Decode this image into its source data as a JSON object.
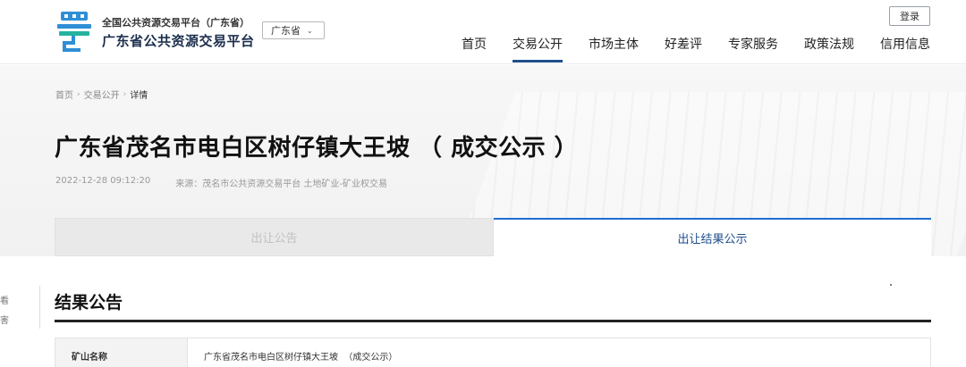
{
  "header": {
    "platform_line1": "全国公共资源交易平台（广东省）",
    "platform_line2": "广东省公共资源交易平台",
    "province_select": "广东省",
    "login_label": "登录",
    "nav": [
      {
        "label": "首页",
        "active": false
      },
      {
        "label": "交易公开",
        "active": true
      },
      {
        "label": "市场主体",
        "active": false
      },
      {
        "label": "好差评",
        "active": false
      },
      {
        "label": "专家服务",
        "active": false
      },
      {
        "label": "政策法规",
        "active": false
      },
      {
        "label": "信用信息",
        "active": false
      }
    ],
    "brand_color": "#1f6ed4"
  },
  "breadcrumb": {
    "items": [
      "首页",
      "交易公开",
      "详情"
    ]
  },
  "article": {
    "title": "广东省茂名市电白区树仔镇大王坡 （ 成交公示 ）",
    "datetime": "2022-12-28 09:12:20",
    "source": "来源：茂名市公共资源交易平台  土地矿业-矿业权交易"
  },
  "tabs": [
    {
      "label": "出让公告",
      "active": false
    },
    {
      "label": "出让结果公示",
      "active": true
    }
  ],
  "side_fragment": [
    "看",
    "害"
  ],
  "section": {
    "title": "结果公告",
    "rows": [
      {
        "label": "矿山名称",
        "value": "广东省茂名市电白区树仔镇大王坡  （成交公示）"
      }
    ]
  }
}
